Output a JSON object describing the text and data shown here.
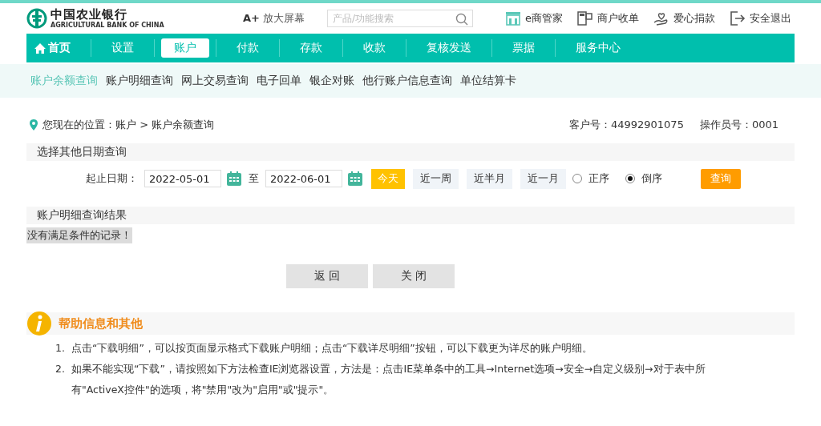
{
  "header": {
    "logo_cn": "中国农业银行",
    "logo_en": "AGRICULTURAL BANK OF CHINA",
    "zoom_key": "A+",
    "zoom_label": "放大屏幕",
    "search": {
      "placeholder": "产品/功能搜索"
    },
    "links": [
      {
        "kind": "shop",
        "label": "e商管家"
      },
      {
        "kind": "pos",
        "label": "商户收单"
      },
      {
        "kind": "heart",
        "label": "爱心捐款"
      },
      {
        "kind": "exit",
        "label": "安全退出"
      }
    ]
  },
  "nav": [
    {
      "label": "首页",
      "kind": "home",
      "selected": false
    },
    {
      "label": "设置",
      "selected": false
    },
    {
      "label": "账户",
      "selected": true
    },
    {
      "label": "付款",
      "selected": false
    },
    {
      "label": "存款",
      "selected": false
    },
    {
      "label": "收款",
      "selected": false
    },
    {
      "label": "复核发送",
      "selected": false
    },
    {
      "label": "票据",
      "selected": false
    },
    {
      "label": "服务中心",
      "selected": false
    }
  ],
  "subnav": [
    {
      "label": "账户余额查询",
      "selected": true
    },
    {
      "label": "账户明细查询",
      "selected": false
    },
    {
      "label": "网上交易查询",
      "selected": false
    },
    {
      "label": "电子回单",
      "selected": false
    },
    {
      "label": "银企对账",
      "selected": false
    },
    {
      "label": "他行账户信息查询",
      "selected": false
    },
    {
      "label": "单位结算卡",
      "selected": false
    }
  ],
  "breadcrumb": "您现在的位置：账户 > 账户余额查询",
  "customer_no": "客户号：44992901075",
  "operator_no": "操作员号：0001",
  "date_section": {
    "title": "选择其他日期查询",
    "label": "起止日期：",
    "start": "2022-05-01",
    "to": "至",
    "end": "2022-06-01",
    "quick": [
      {
        "label": "今天",
        "selected": true
      },
      {
        "label": "近一周",
        "selected": false
      },
      {
        "label": "近半月",
        "selected": false
      },
      {
        "label": "近一月",
        "selected": false
      }
    ],
    "order": [
      {
        "label": "正序",
        "selected": false
      },
      {
        "label": "倒序",
        "selected": true
      }
    ],
    "query": "查询"
  },
  "result": {
    "title": "账户明细查询结果",
    "message": "没有满足条件的记录！"
  },
  "buttons": [
    "返 回",
    "关 闭"
  ],
  "help": {
    "title": "帮助信息和其他",
    "items": [
      {
        "number": "1.",
        "text": "点击“下载明细”，可以按页面显示格式下载账户明细；点击“下载详尽明细”按钮，可以下载更为详尽的账户明细。"
      },
      {
        "number": "2.",
        "text": "如果不能实现“下载”，请按照如下方法检查IE浏览器设置，方法是：点击IE菜单条中的工具→Internet选项→安全→自定义级别→对于表中所有\"ActiveX控件\"的选项，将\"禁用\"改为\"启用\"或\"提示\"。"
      }
    ]
  }
}
